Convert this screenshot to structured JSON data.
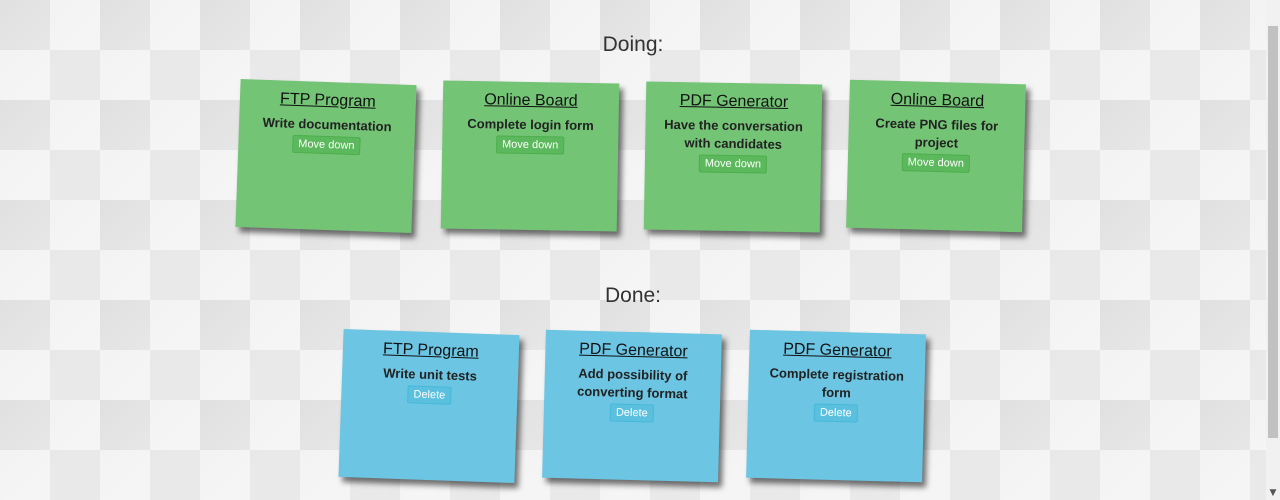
{
  "doing": {
    "title": "Doing:",
    "notes": [
      {
        "title": "FTP Program",
        "text": "Write documentation",
        "button": "Move down"
      },
      {
        "title": "Online Board",
        "text": "Complete login form",
        "button": "Move down"
      },
      {
        "title": "PDF Generator",
        "text": "Have the conversation with candidates",
        "button": "Move down"
      },
      {
        "title": "Online Board",
        "text": "Create PNG files for project",
        "button": "Move down"
      }
    ]
  },
  "done": {
    "title": "Done:",
    "notes": [
      {
        "title": "FTP Program",
        "text": "Write unit tests",
        "button": "Delete"
      },
      {
        "title": "PDF Generator",
        "text": "Add possibility of converting format",
        "button": "Delete"
      },
      {
        "title": "PDF Generator",
        "text": "Complete registration form",
        "button": "Delete"
      }
    ]
  },
  "colors": {
    "doing_note": "#74c476",
    "done_note": "#6cc5e3"
  },
  "scrollbar": {
    "down_arrow_icon": "chevron-down-icon"
  }
}
